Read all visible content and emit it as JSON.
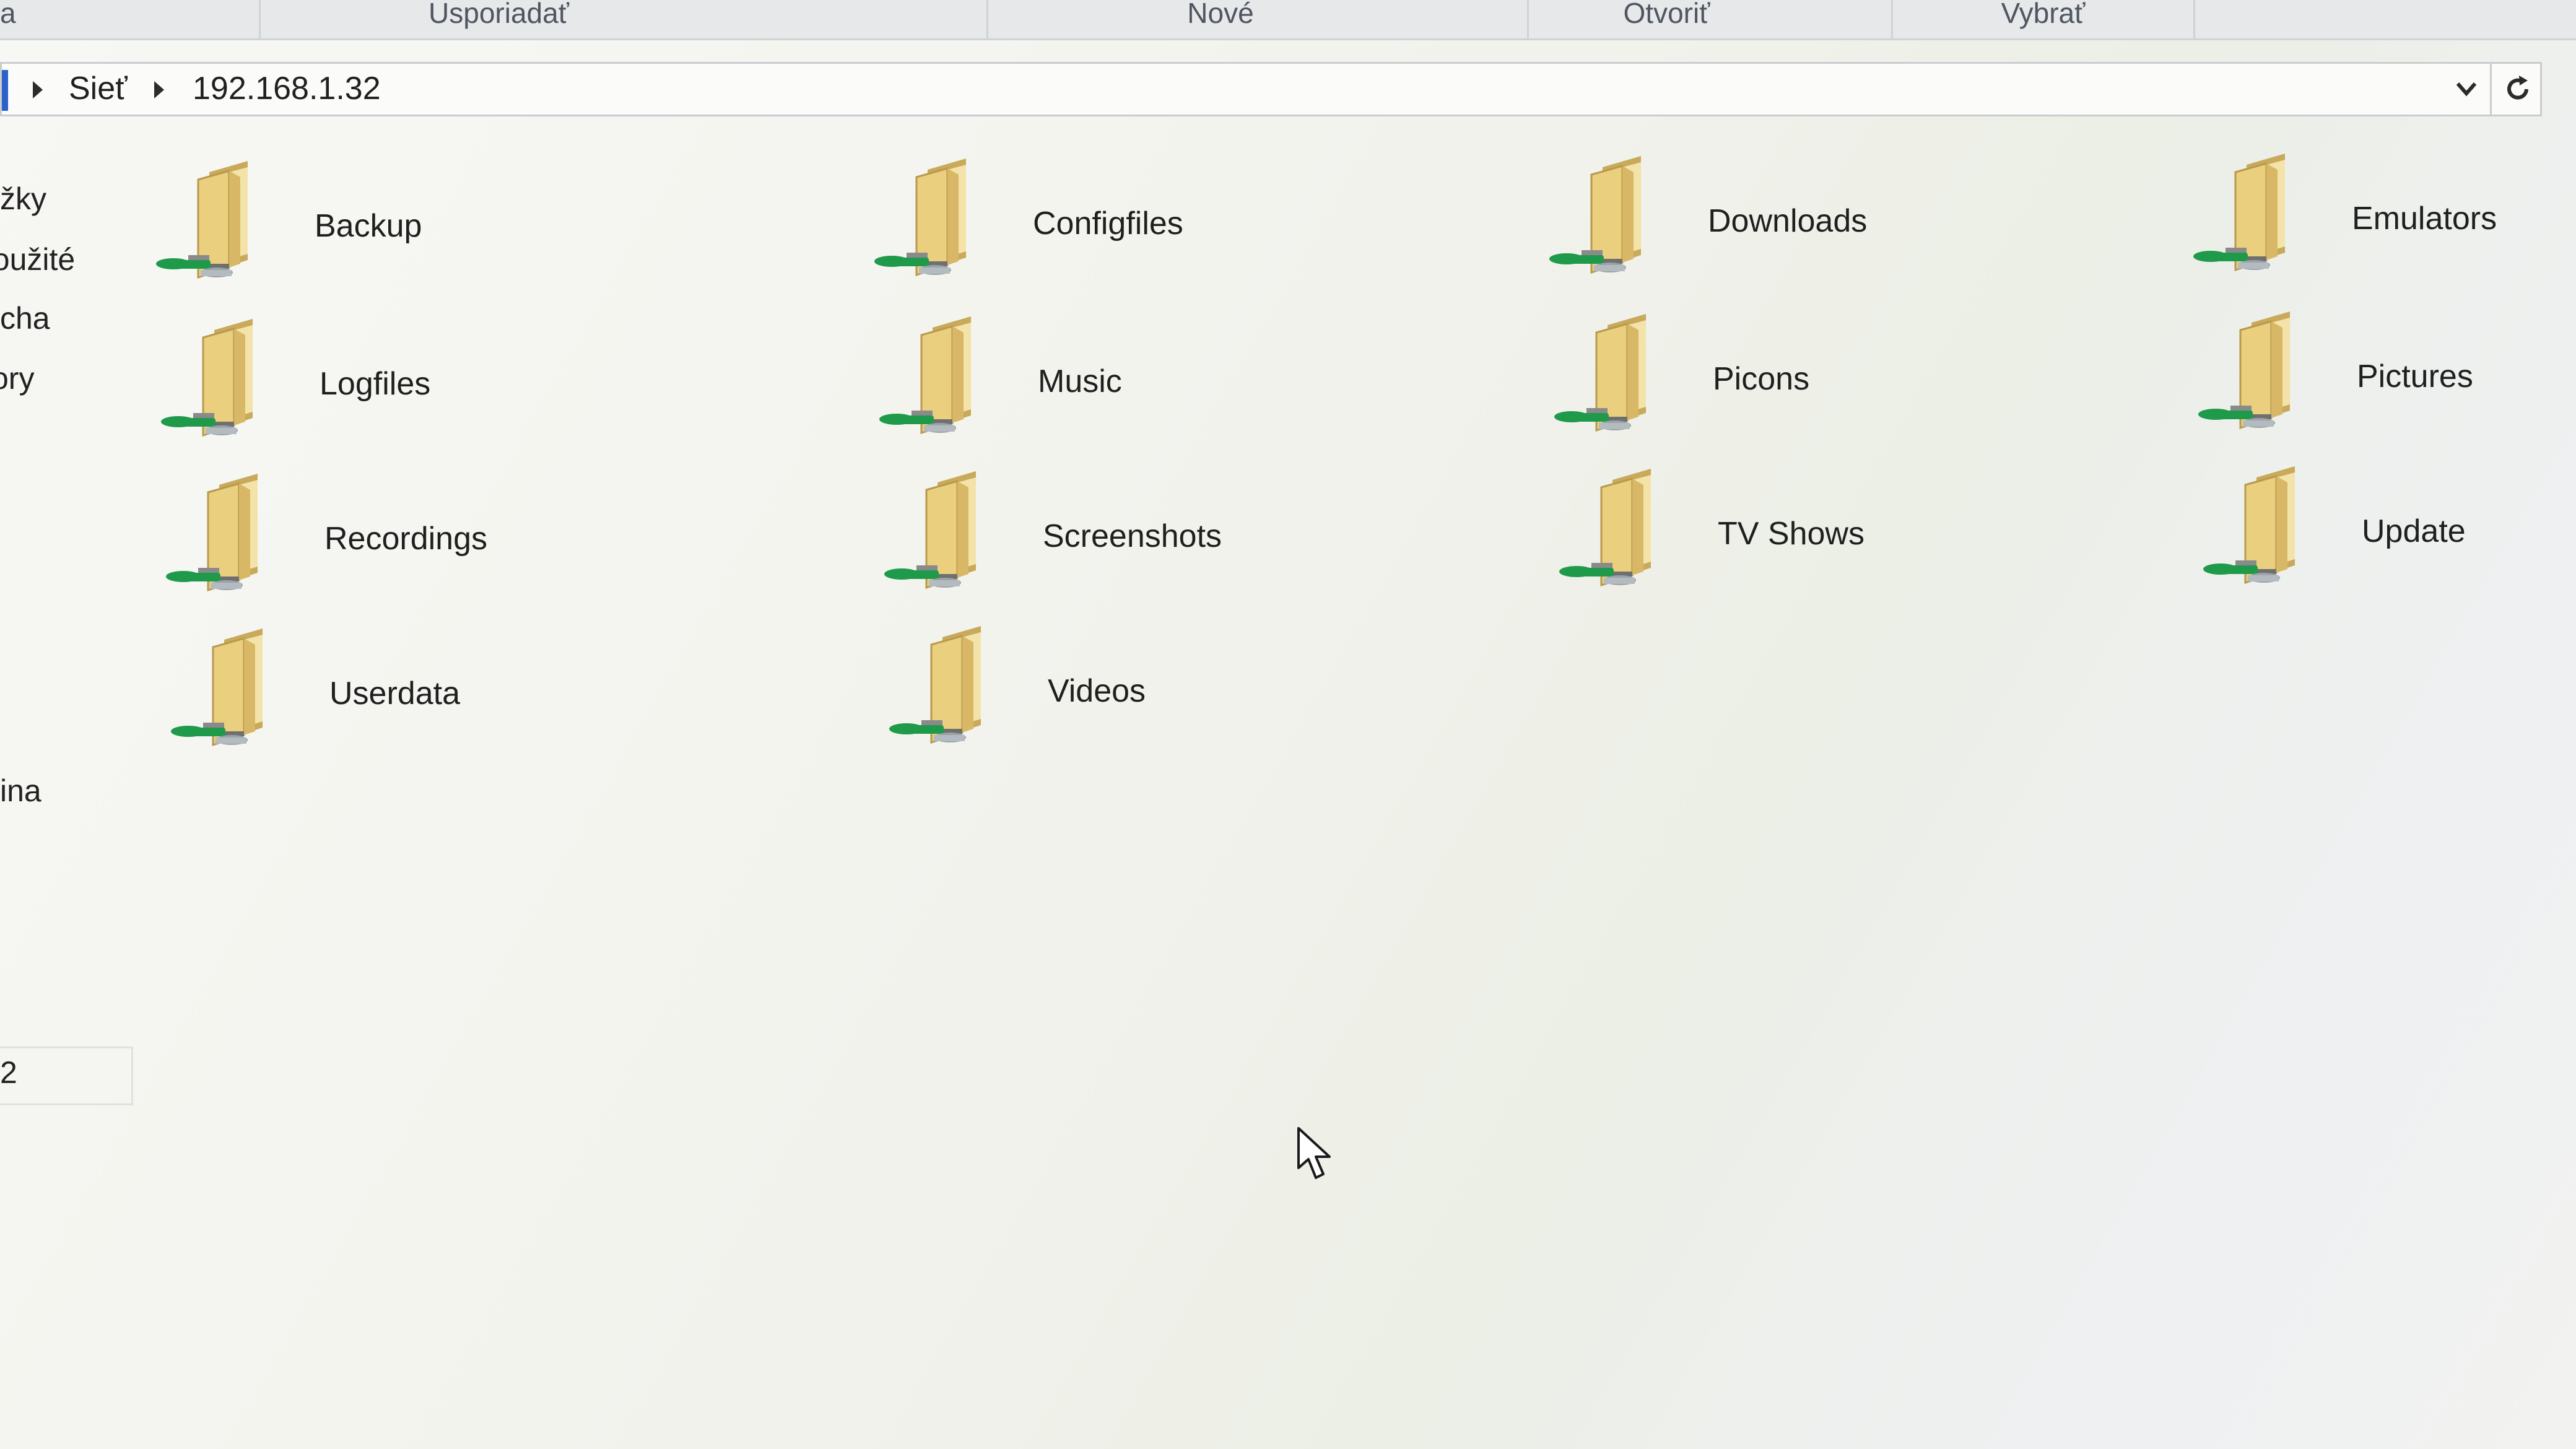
{
  "ribbon": {
    "groups": [
      {
        "label": "a"
      },
      {
        "label": "Usporiadať"
      },
      {
        "label": "Nové"
      },
      {
        "label": "Otvoriť"
      },
      {
        "label": "Vybrať"
      }
    ]
  },
  "address_bar": {
    "breadcrumbs": [
      "Sieť",
      "192.168.1.32"
    ]
  },
  "nav_pane": {
    "items": [
      "žky",
      "použité",
      "cha",
      "ory",
      "ina",
      "2"
    ]
  },
  "folders": [
    "Backup",
    "Configfiles",
    "Downloads",
    "Emulators",
    "Logfiles",
    "Music",
    "Picons",
    "Pictures",
    "Recordings",
    "Screenshots",
    "TV Shows",
    "Update",
    "Userdata",
    "Videos"
  ],
  "colors": {
    "folder": "#e9cf7e",
    "network_connector": "#1f9a4a",
    "address_accent": "#2a62c9"
  }
}
